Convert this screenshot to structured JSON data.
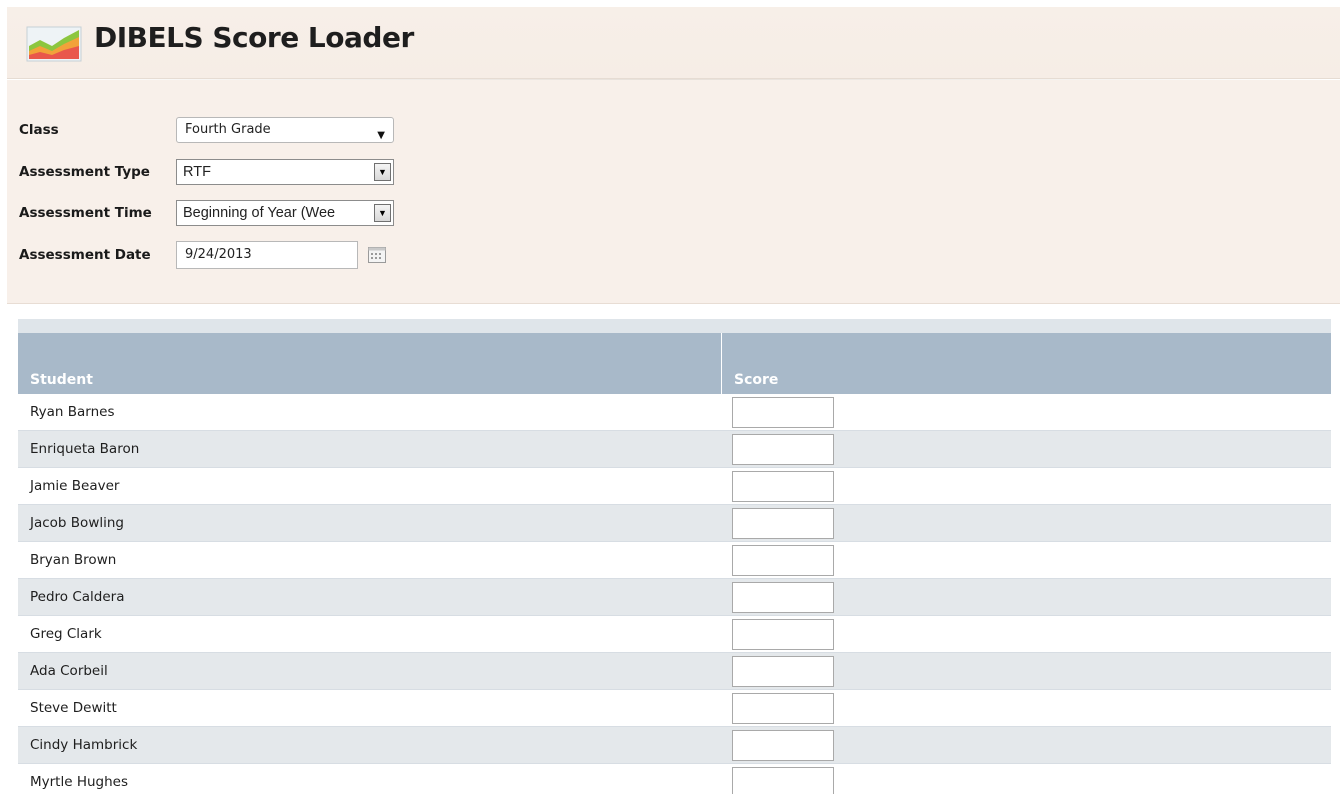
{
  "app": {
    "title": "DIBELS Score Loader",
    "logo_icon": "chart-icon"
  },
  "filters": {
    "class": {
      "label": "Class",
      "value": "Fourth Grade"
    },
    "assessment_type": {
      "label": "Assessment Type",
      "value": "RTF"
    },
    "assessment_time": {
      "label": "Assessment Time",
      "value": "Beginning of Year (Wee"
    },
    "assessment_date": {
      "label": "Assessment Date",
      "value": "9/24/2013",
      "icon": "calendar-icon"
    }
  },
  "grid": {
    "columns": [
      "Student",
      "Score"
    ],
    "rows": [
      {
        "student": "Ryan Barnes",
        "score": ""
      },
      {
        "student": "Enriqueta Baron",
        "score": ""
      },
      {
        "student": "Jamie Beaver",
        "score": ""
      },
      {
        "student": "Jacob Bowling",
        "score": ""
      },
      {
        "student": "Bryan Brown",
        "score": ""
      },
      {
        "student": "Pedro Caldera",
        "score": ""
      },
      {
        "student": "Greg Clark",
        "score": ""
      },
      {
        "student": "Ada Corbeil",
        "score": ""
      },
      {
        "student": "Steve Dewitt",
        "score": ""
      },
      {
        "student": "Cindy Hambrick",
        "score": ""
      },
      {
        "student": "Myrtle Hughes",
        "score": ""
      }
    ]
  },
  "colors": {
    "header_bg": "#f7efe8",
    "grid_header": "#a8b9c9",
    "row_alt": "#e4e8eb"
  }
}
